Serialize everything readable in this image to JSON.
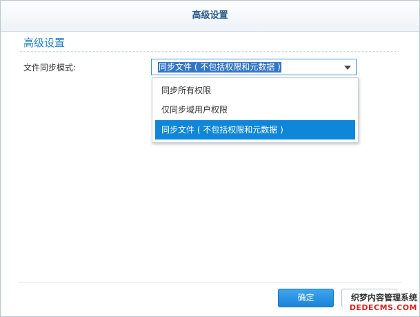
{
  "dialog": {
    "title": "高级设置"
  },
  "section": {
    "title": "高级设置"
  },
  "field": {
    "label": "文件同步模式:"
  },
  "select": {
    "selected_value": "同步文件 ( 不包括权限和元数据 )",
    "options": [
      "同步所有权限",
      "仅同步域用户权限",
      "同步文件 ( 不包括权限和元数据 )"
    ],
    "highlighted_index": 2
  },
  "footer": {
    "ok_label": "确定"
  },
  "watermark": {
    "line1": "织梦内容管理系统",
    "line2": "DEDECMS.COM"
  },
  "colors": {
    "accent": "#1f7ecb",
    "selection": "#0f86d9",
    "title_text": "#2a5c8a"
  }
}
